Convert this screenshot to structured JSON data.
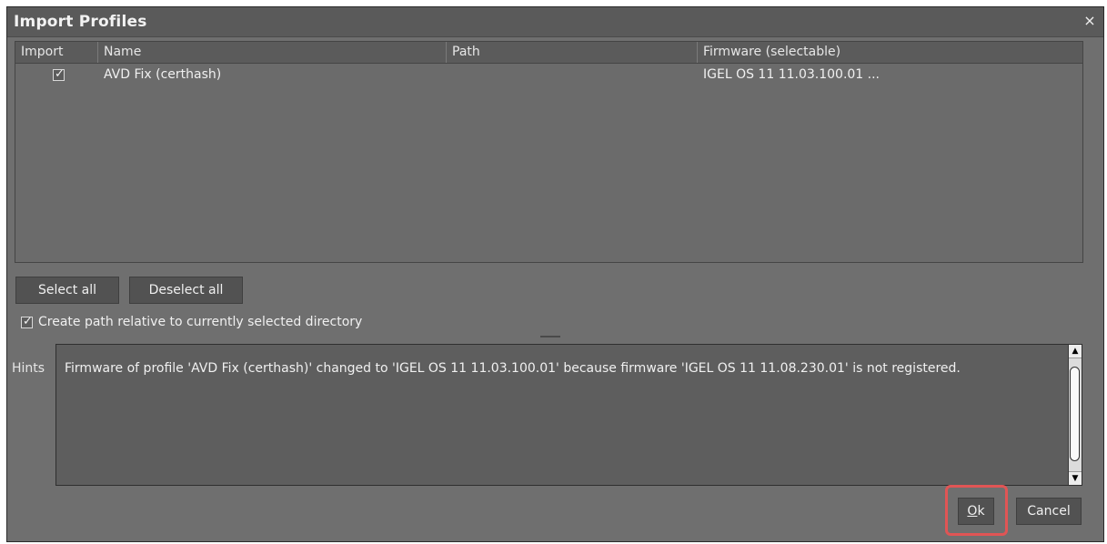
{
  "window": {
    "title": "Import Profiles",
    "close_glyph": "×"
  },
  "table": {
    "columns": [
      "Import",
      "Name",
      "Path",
      "Firmware (selectable)"
    ],
    "rows": [
      {
        "import_checked": "✓",
        "name": "AVD Fix (certhash)",
        "path": "",
        "firmware": "IGEL OS 11 11.03.100.01 ..."
      }
    ]
  },
  "buttons": {
    "select_all": "Select all",
    "deselect_all": "Deselect all",
    "ok": "Ok",
    "ok_mnemonic": "O",
    "ok_rest": "k",
    "cancel": "Cancel"
  },
  "options": {
    "relative_path_checked": "✓",
    "relative_path_label": "Create path relative to currently selected directory"
  },
  "hints": {
    "label": "Hints",
    "text": "Firmware of profile 'AVD Fix (certhash)' changed to 'IGEL OS 11 11.03.100.01' because firmware 'IGEL OS 11 11.08.230.01' is not registered."
  },
  "colors": {
    "dialog_bg": "#6f6f6f",
    "highlight": "#e05555"
  },
  "icons": {
    "close": "close-icon",
    "scroll_up": "up-arrow-icon",
    "scroll_down": "down-arrow-icon"
  }
}
